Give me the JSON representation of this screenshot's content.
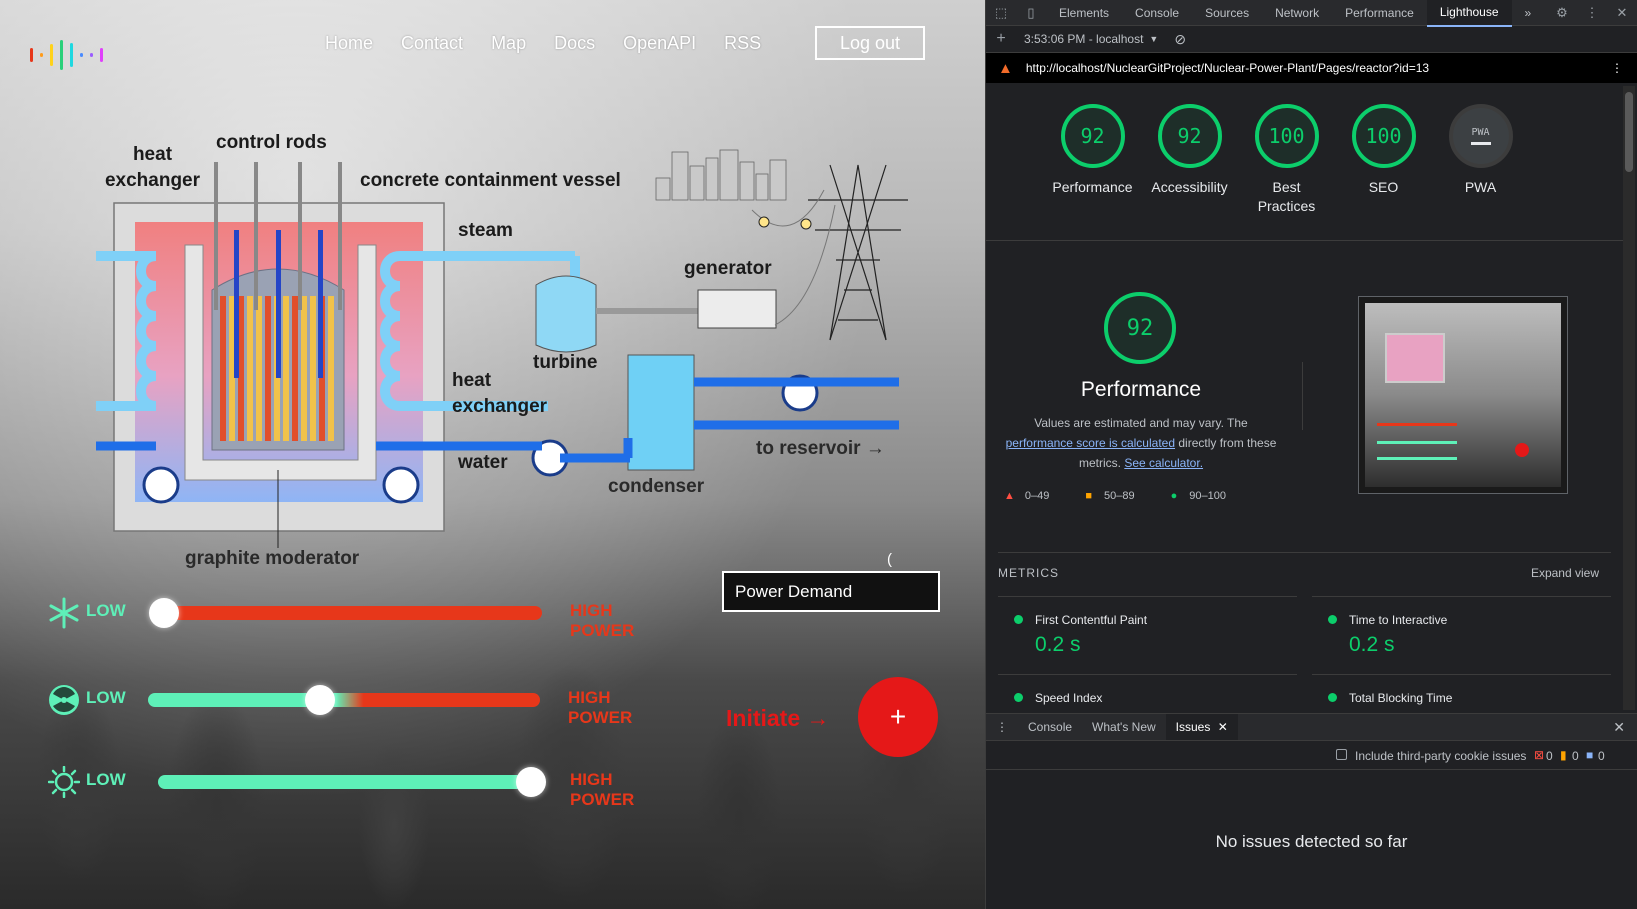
{
  "app": {
    "logo_bar_colors": [
      "#e7371a",
      "#ff9c1a",
      "#2ad07a",
      "#1fd8e0",
      "#9b5cff",
      "#e040fb"
    ],
    "nav": [
      "Home",
      "Contact",
      "Map",
      "Docs",
      "OpenAPI",
      "RSS"
    ],
    "logout_label": "Log out",
    "diagram_labels": {
      "heat_exchanger_left": "heat exchanger",
      "control_rods": "control rods",
      "containment": "concrete containment vessel",
      "steam": "steam",
      "generator": "generator",
      "turbine": "turbine",
      "heat_exchanger_right": "heat exchanger",
      "water": "water",
      "condenser": "condenser",
      "to_reservoir": "to reservoir →",
      "graphite": "graphite moderator"
    },
    "sliders": [
      {
        "icon": "snowflake-icon",
        "low": "LOW",
        "high": "HIGH POWER",
        "level": 0.0
      },
      {
        "icon": "radiation-icon",
        "low": "LOW",
        "high": "HIGH POWER",
        "level": 0.5
      },
      {
        "icon": "sun-icon",
        "low": "LOW",
        "high": "HIGH POWER",
        "level": 1.0
      }
    ],
    "stray_text": "(",
    "power_demand_placeholder": "Power Demand",
    "initiate_label": "Initiate →",
    "plus_label": "+",
    "accent_red": "#e51818",
    "accent_green": "#5ef0b8"
  },
  "devtools": {
    "tabs": [
      "Elements",
      "Console",
      "Sources",
      "Network",
      "Performance",
      "Lighthouse"
    ],
    "active_tab": "Lighthouse",
    "more_icon": "»",
    "timestamp": "3:53:06 PM - localhost",
    "url": "http://localhost/NuclearGitProject/Nuclear-Power-Plant/Pages/reactor?id=13",
    "scores": [
      {
        "label": "Performance",
        "score": "92"
      },
      {
        "label": "Accessibility",
        "score": "92"
      },
      {
        "label": "Best Practices",
        "score": "100"
      },
      {
        "label": "SEO",
        "score": "100"
      },
      {
        "label": "PWA",
        "score": "PWA"
      }
    ],
    "perf": {
      "score": "92",
      "title": "Performance",
      "note_1": "Values are estimated and may vary. The",
      "note_link_1": "performance score is calculated",
      "note_2": "directly from these metrics.",
      "note_link_2": "See calculator."
    },
    "legend": [
      "0–49",
      "50–89",
      "90–100"
    ],
    "metrics_heading": "METRICS",
    "expand_view": "Expand view",
    "metrics": [
      {
        "name": "First Contentful Paint",
        "value": "0.2 s"
      },
      {
        "name": "Time to Interactive",
        "value": "0.2 s"
      },
      {
        "name": "Speed Index",
        "value": ""
      },
      {
        "name": "Total Blocking Time",
        "value": ""
      }
    ],
    "drawer_tabs": [
      "Console",
      "What's New",
      "Issues"
    ],
    "active_drawer_tab": "Issues",
    "third_party_label": "Include third-party cookie issues",
    "counts": {
      "errors": "0",
      "warnings": "0",
      "info": "0"
    },
    "no_issues": "No issues detected so far"
  }
}
